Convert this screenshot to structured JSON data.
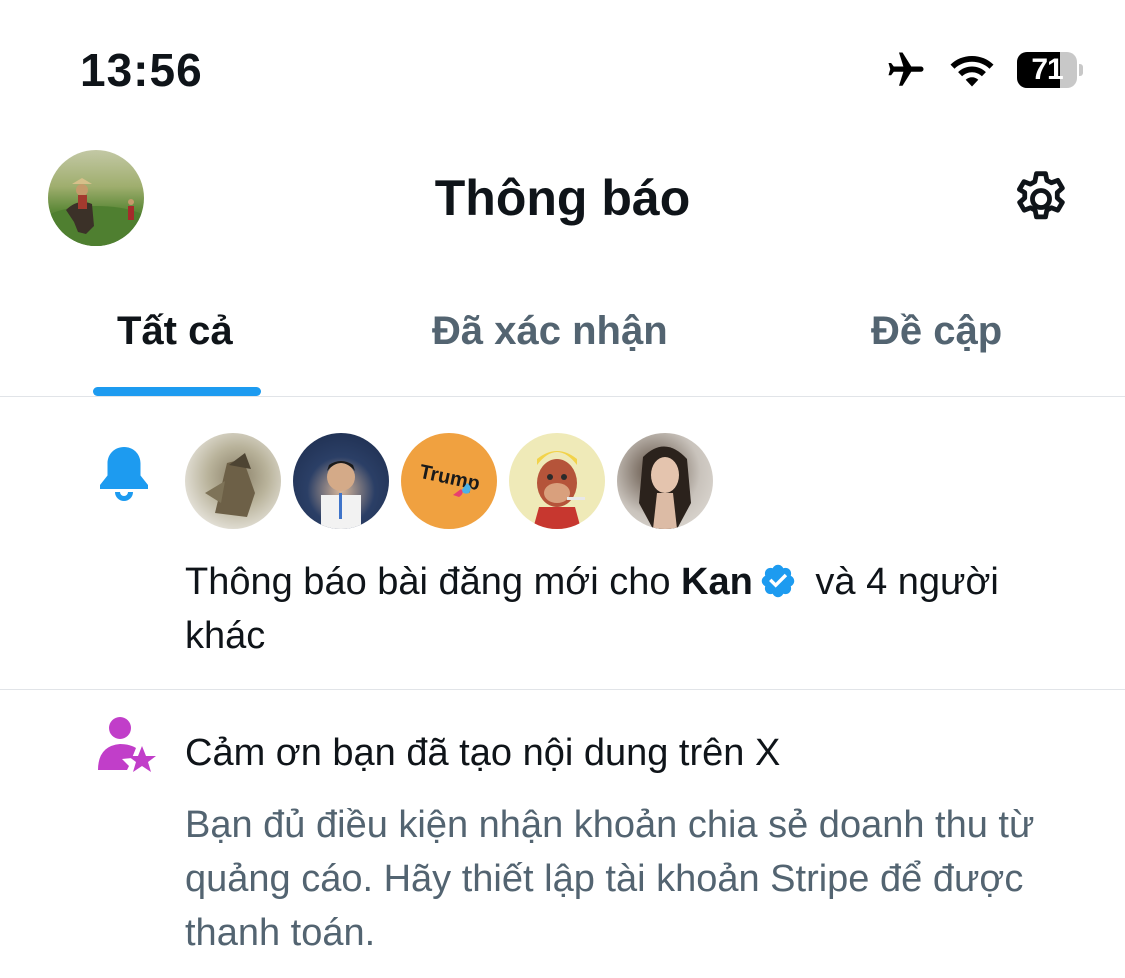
{
  "status_bar": {
    "time": "13:56",
    "battery_level": "71",
    "battery_fraction": 0.71,
    "icons": [
      "airplane-icon",
      "wifi-icon",
      "battery-icon"
    ]
  },
  "header": {
    "title": "Thông báo",
    "settings_icon": "gear-icon"
  },
  "tabs": [
    {
      "label": "Tất cả",
      "active": true
    },
    {
      "label": "Đã xác nhận",
      "active": false
    },
    {
      "label": "Đề cập",
      "active": false
    }
  ],
  "notifications": [
    {
      "type": "new-post-alert",
      "icon": "bell-icon",
      "avatar_count": 5,
      "avatar3_text": "Trump",
      "text_prefix": "Thông báo bài đăng mới cho ",
      "user_name": "Kan",
      "verified": true,
      "text_suffix": " và 4 người khác"
    },
    {
      "type": "creator-revenue",
      "icon": "creator-star-icon",
      "title": "Cảm ơn bạn đã tạo nội dung trên X",
      "body": "Bạn đủ điều kiện nhận khoản chia sẻ doanh thu từ quảng cáo. Hãy thiết lập tài khoản Stripe để được thanh toán."
    }
  ],
  "colors": {
    "accent": "#1d9bf0",
    "bell": "#1d9bf0",
    "creator_icon": "#c13ec9",
    "text_primary": "#0f1419",
    "text_secondary": "#536471",
    "divider": "#e1e4e8"
  }
}
